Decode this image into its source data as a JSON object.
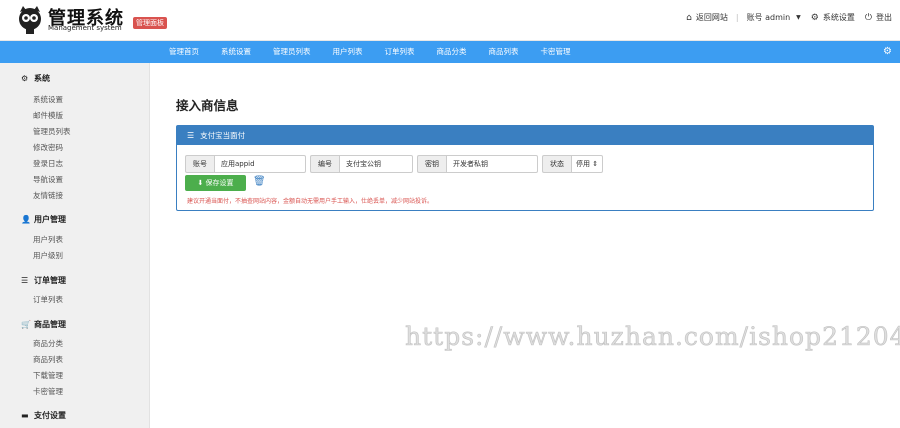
{
  "header": {
    "logo_title": "管理系统",
    "logo_subtitle": "Management system",
    "admin_tag": "管理面板",
    "links": {
      "back_site": "返回网站",
      "account": "账号 admin",
      "settings": "系统设置",
      "logout": "登出"
    }
  },
  "navbar": {
    "items": [
      "管理首页",
      "系统设置",
      "管理员列表",
      "用户列表",
      "订单列表",
      "商品分类",
      "商品列表",
      "卡密管理"
    ]
  },
  "sidebar": {
    "groups": [
      {
        "title": "系统",
        "icon": "gear-icon",
        "items": [
          "系统设置",
          "邮件模版",
          "管理员列表",
          "修改密码",
          "登录日志",
          "导航设置",
          "友情链接"
        ]
      },
      {
        "title": "用户管理",
        "icon": "user-icon",
        "items": [
          "用户列表",
          "用户级别"
        ]
      },
      {
        "title": "订单管理",
        "icon": "list-icon",
        "items": [
          "订单列表"
        ]
      },
      {
        "title": "商品管理",
        "icon": "cart-icon",
        "items": [
          "商品分类",
          "商品列表",
          "下载管理",
          "卡密管理"
        ]
      },
      {
        "title": "支付设置",
        "icon": "card-icon",
        "items": []
      }
    ]
  },
  "main": {
    "page_title": "接入商信息",
    "panel_title": "支付宝当面付",
    "form": {
      "account_label": "账号",
      "account_value": "应用appid",
      "code_label": "编号",
      "code_value": "支付宝公钥",
      "key_label": "密钥",
      "key_value": "开发者私钥",
      "status_label": "状态",
      "status_value": "停用"
    },
    "save_label": "保存设置",
    "notice": "建议开通当面付，不抽查网站内容，金额自动无需用户手工输入，仕绝丢单，减少网站投诉。"
  },
  "watermark": "https://www.huzhan.com/ishop21204",
  "colors": {
    "nav": "#3c9df2",
    "panel": "#3a7fc1",
    "save": "#4cae4c",
    "tag": "#d9534f"
  }
}
